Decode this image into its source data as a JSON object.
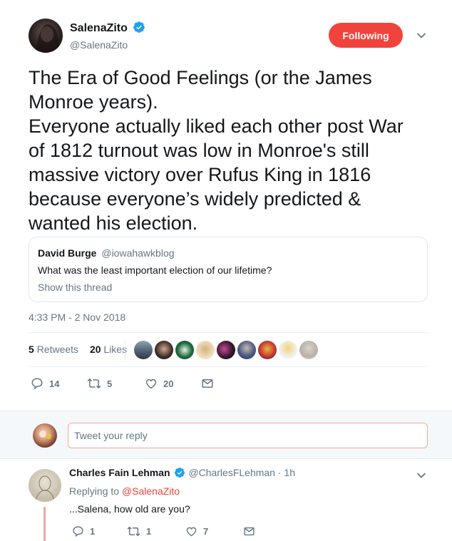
{
  "tweet": {
    "author_name": "SalenaZito",
    "author_handle": "@SalenaZito",
    "follow_label": "Following",
    "text_lines": [
      "The Era of Good Feelings (or the James",
      "Monroe years).",
      "Everyone actually liked each other post War",
      "of 1812 turnout was low in Monroe's still",
      "massive victory over Rufus King in 1816",
      "because everyone’s widely predicted &",
      "wanted his election."
    ],
    "timestamp": "4:33 PM - 2 Nov 2018",
    "retweets_count": "5",
    "retweets_label": "Retweets",
    "likes_count": "20",
    "likes_label": "Likes",
    "actions": {
      "replies": "14",
      "retweets": "5",
      "likes": "20"
    }
  },
  "quote": {
    "author_name": "David Burge",
    "author_handle": "@iowahawkblog",
    "text": "What was the least important election of our lifetime?",
    "link": "Show this thread"
  },
  "reply_box": {
    "placeholder": "Tweet your reply"
  },
  "reply": {
    "author_name": "Charles Fain Lehman",
    "author_handle": "@CharlesFLehman",
    "time": "· 1h",
    "replying_prefix": "Replying to",
    "replying_handle": "@SalenaZito",
    "text": "...Salena, how old are you?",
    "actions": {
      "replies": "1",
      "retweets": "1",
      "likes": "7"
    }
  },
  "colors": {
    "accent": "#f0433b",
    "verified": "#1da1f2",
    "muted": "#657786"
  }
}
